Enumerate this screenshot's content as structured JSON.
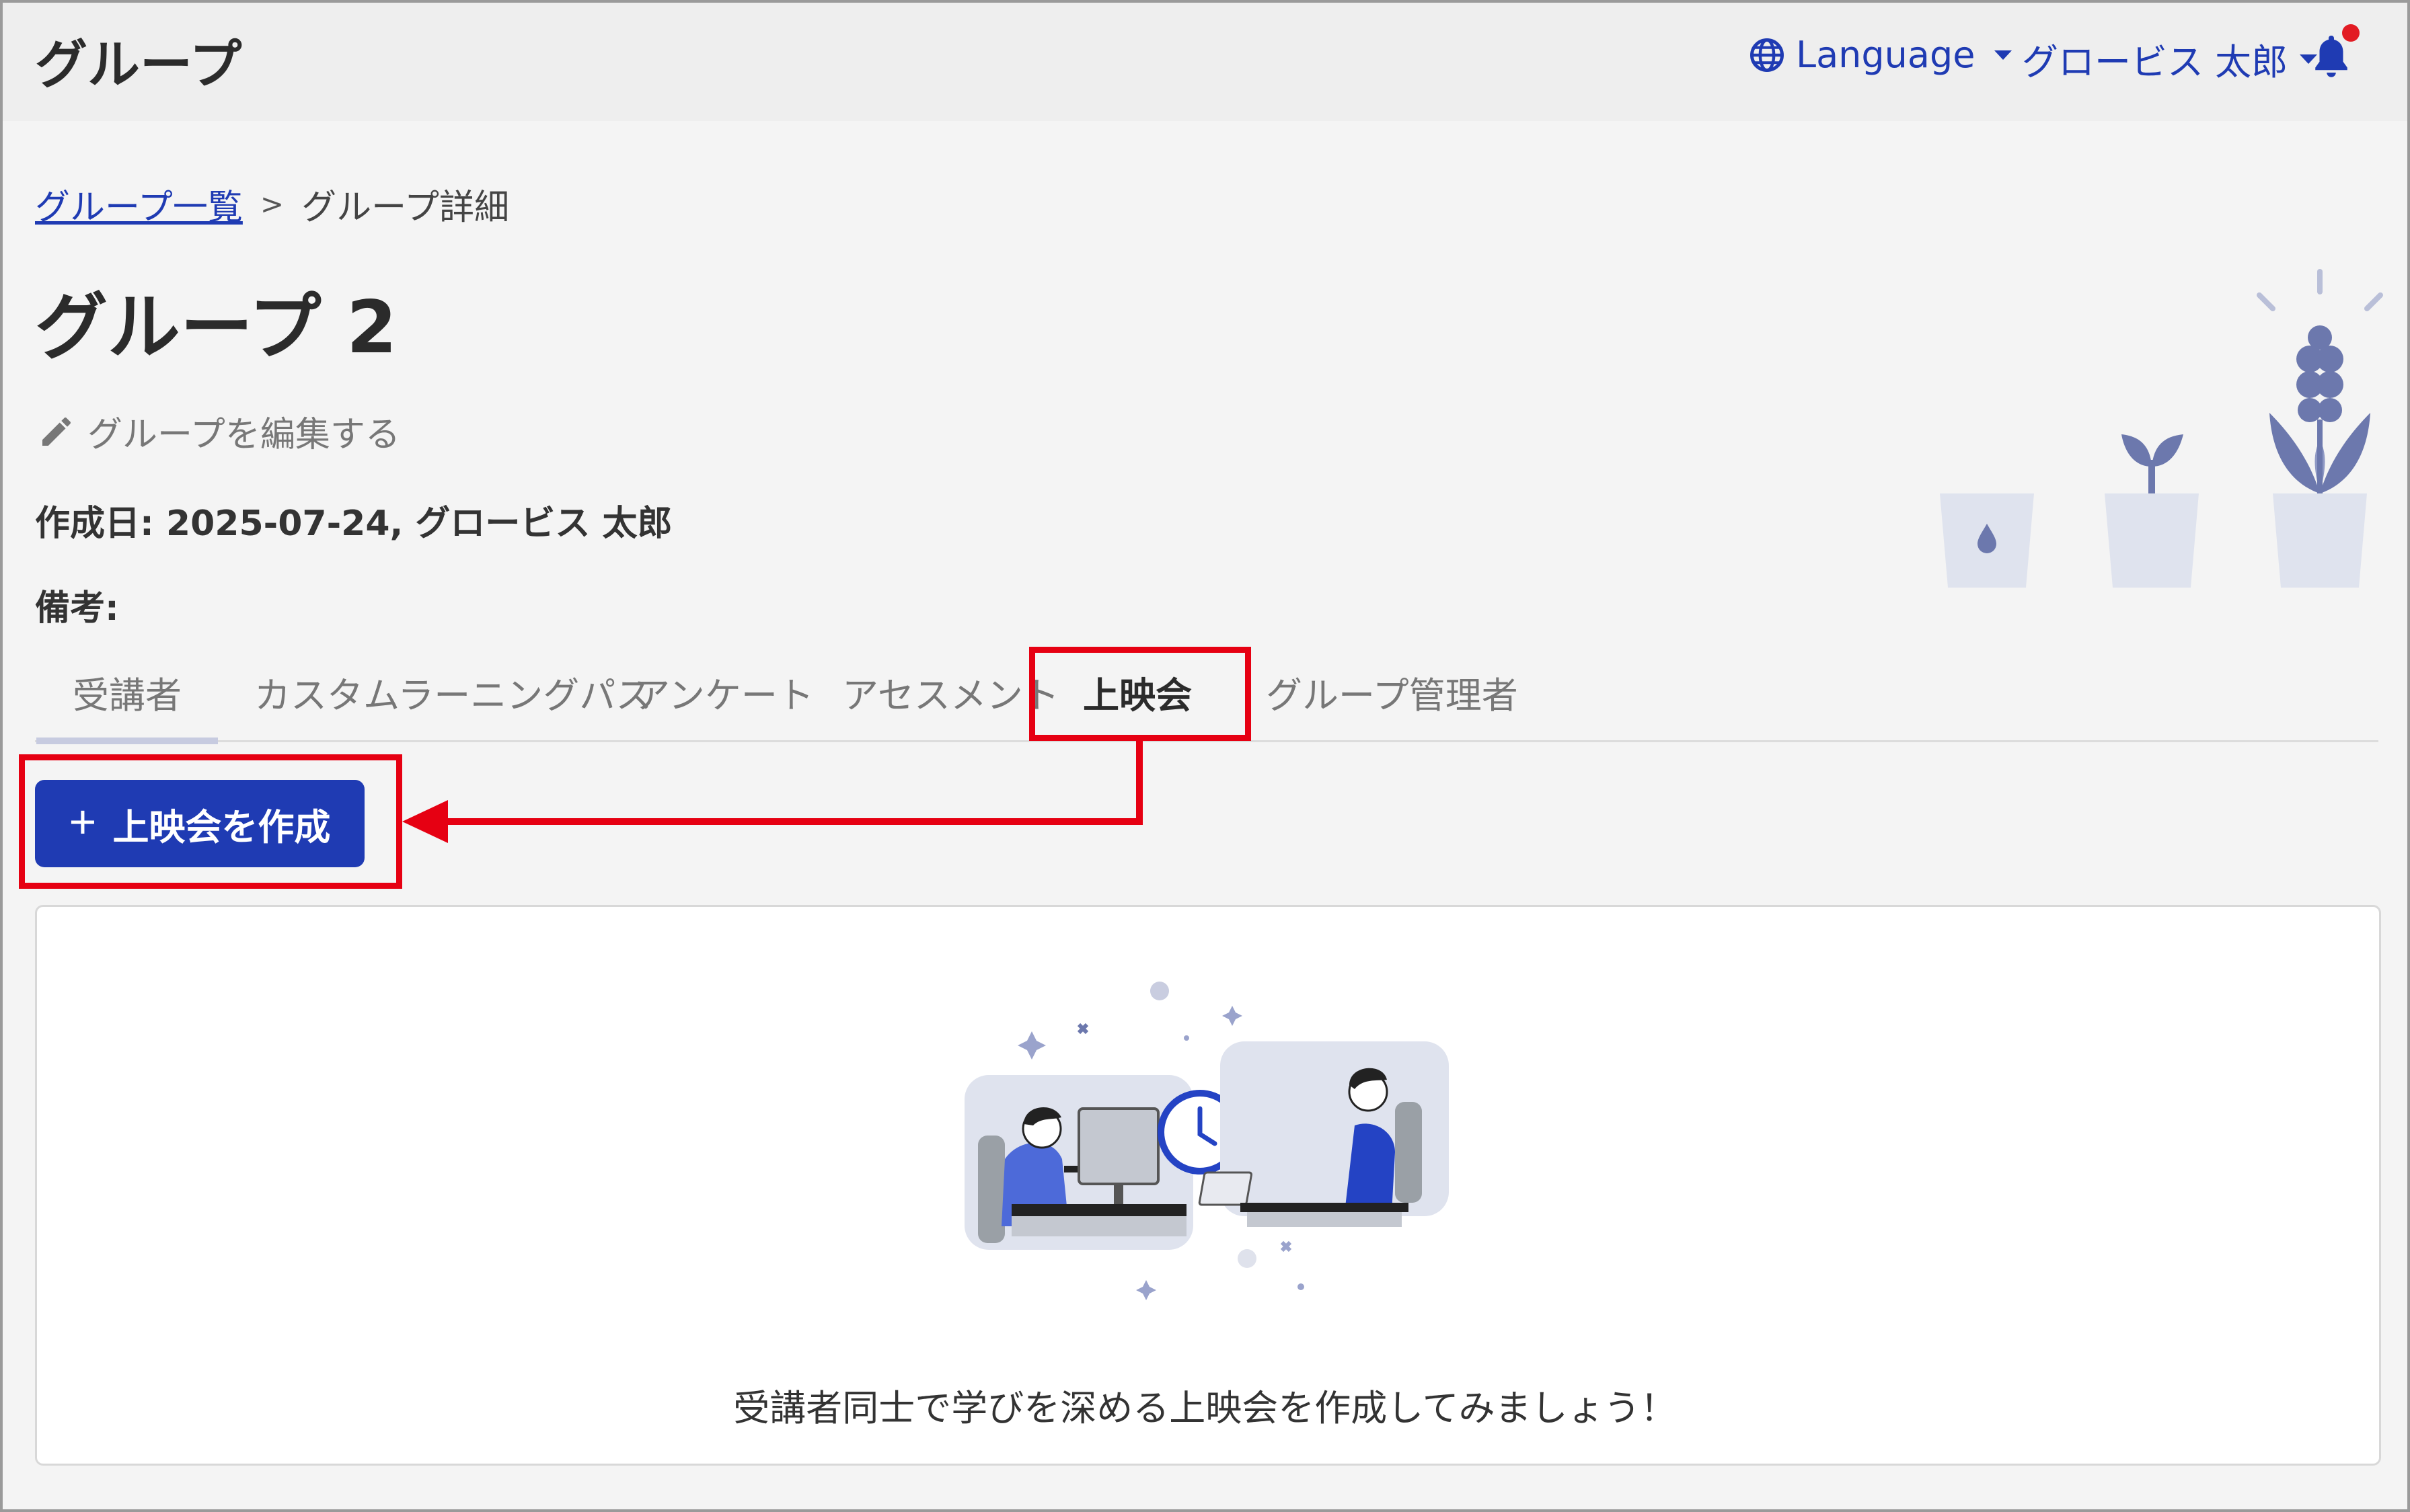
{
  "header": {
    "app_title": "グループ",
    "language_label": "Language",
    "user_name": "グロービス 太郎"
  },
  "breadcrumb": {
    "parent": "グループ一覧",
    "separator": ">",
    "current": "グループ詳細"
  },
  "group": {
    "title": "グループ 2",
    "edit_label": "グループを編集する",
    "created_label": "作成日: 2025-07-24, グロービス 太郎",
    "note_label": "備考:"
  },
  "tabs": [
    {
      "label": "受講者"
    },
    {
      "label": "カスタムラーニングパス"
    },
    {
      "label": "アンケート"
    },
    {
      "label": "アセスメント"
    },
    {
      "label": "上映会"
    },
    {
      "label": "グループ管理者"
    }
  ],
  "actions": {
    "create_label": "上映会を作成"
  },
  "empty_state": {
    "message": "受講者同士で学びを深める上映会を作成してみましょう！"
  },
  "colors": {
    "primary": "#1f3bb3",
    "highlight": "#e60012",
    "notification": "#e21b23"
  }
}
